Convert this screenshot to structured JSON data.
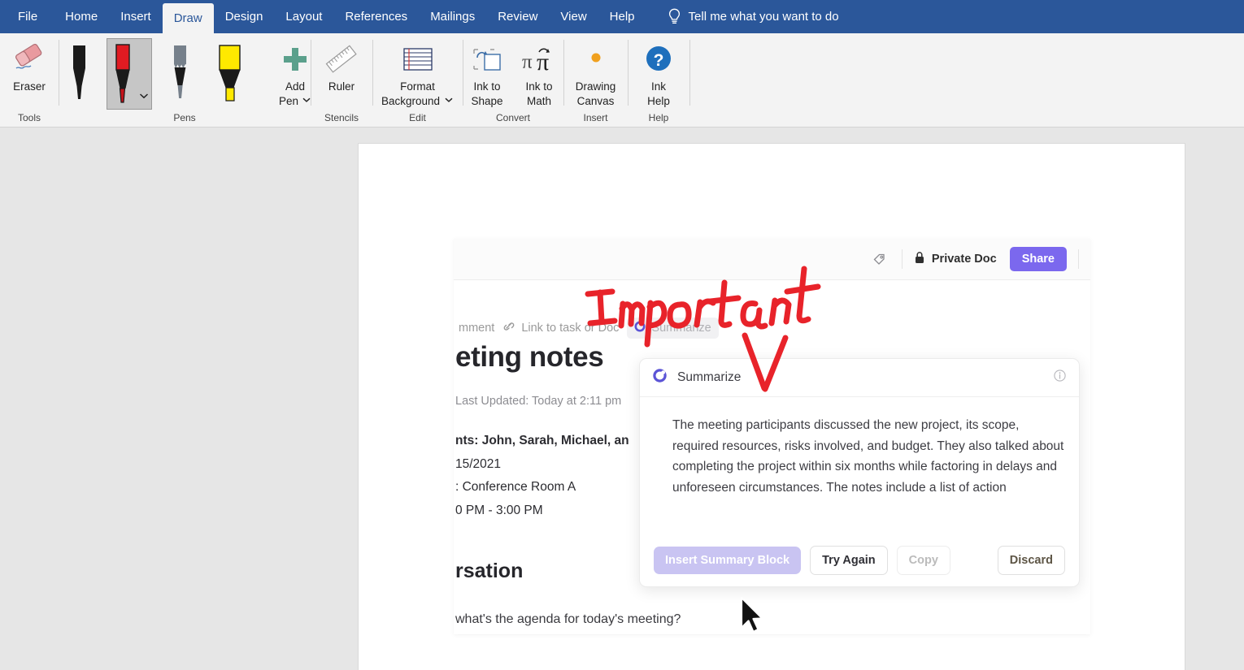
{
  "app": {
    "tabs": [
      {
        "label": "File",
        "active": false
      },
      {
        "label": "Home",
        "active": false
      },
      {
        "label": "Insert",
        "active": false
      },
      {
        "label": "Draw",
        "active": true
      },
      {
        "label": "Design",
        "active": false
      },
      {
        "label": "Layout",
        "active": false
      },
      {
        "label": "References",
        "active": false
      },
      {
        "label": "Mailings",
        "active": false
      },
      {
        "label": "Review",
        "active": false
      },
      {
        "label": "View",
        "active": false
      },
      {
        "label": "Help",
        "active": false
      }
    ],
    "tell_me": "Tell me what you want to do",
    "tell_me_icon": "lightbulb-icon"
  },
  "ribbon": {
    "groups": [
      {
        "name": "Tools",
        "label": "Tools",
        "items": [
          {
            "label": "Eraser",
            "icon": "eraser-icon"
          }
        ]
      },
      {
        "name": "Pens",
        "label": "Pens",
        "items": [
          {
            "label": "",
            "icon": "pen-black-icon",
            "selected": false
          },
          {
            "label": "",
            "icon": "pen-red-icon",
            "selected": true
          },
          {
            "label": "",
            "icon": "pencil-grey-icon",
            "selected": false
          },
          {
            "label": "",
            "icon": "highlighter-yellow-icon",
            "selected": false
          },
          {
            "label": "Add Pen",
            "icon": "plus-icon",
            "selected": false
          }
        ]
      },
      {
        "name": "Stencils",
        "label": "Stencils",
        "items": [
          {
            "label": "Ruler",
            "icon": "ruler-icon"
          }
        ]
      },
      {
        "name": "Edit",
        "label": "Edit",
        "items": [
          {
            "label": "Format Background",
            "icon": "format-background-icon"
          }
        ]
      },
      {
        "name": "Convert",
        "label": "Convert",
        "items": [
          {
            "label": "Ink to Shape",
            "icon": "ink-to-shape-icon"
          },
          {
            "label": "Ink to Math",
            "icon": "ink-to-math-icon"
          }
        ]
      },
      {
        "name": "Insert",
        "label": "Insert",
        "items": [
          {
            "label": "Drawing Canvas",
            "icon": "drawing-canvas-icon"
          }
        ]
      },
      {
        "name": "Help",
        "label": "Help",
        "items": [
          {
            "label": "Ink Help",
            "icon": "question-mark-icon"
          }
        ]
      }
    ],
    "labels": {
      "eraser": "Eraser",
      "add_pen_line1": "Add",
      "add_pen_line2": "Pen",
      "ruler": "Ruler",
      "format_bg_line1": "Format",
      "format_bg_line2": "Background",
      "ink_shape_line1": "Ink to",
      "ink_shape_line2": "Shape",
      "ink_math_line1": "Ink to",
      "ink_math_line2": "Math",
      "canvas_line1": "Drawing",
      "canvas_line2": "Canvas",
      "ink_help_line1": "Ink",
      "ink_help_line2": "Help",
      "group_tools": "Tools",
      "group_pens": "Pens",
      "group_stencils": "Stencils",
      "group_edit": "Edit",
      "group_convert": "Convert",
      "group_insert": "Insert",
      "group_help": "Help"
    }
  },
  "embedded_screenshot": {
    "header": {
      "tag_icon": "tag-icon",
      "lock_icon": "lock-icon",
      "privacy_label": "Private Doc",
      "share_label": "Share"
    },
    "toolbar": {
      "comment_label": "mment",
      "link_icon": "link-icon",
      "link_label": "Link to task or Doc",
      "summarize_icon": "ai-sparkle-icon",
      "summarize_label": "Summarize"
    },
    "document": {
      "title": "eting notes",
      "last_updated": "Last Updated: Today at 2:11 pm",
      "meta_lines": [
        "nts: John, Sarah, Michael, an",
        "15/2021",
        ": Conference Room A",
        "0 PM - 3:00 PM"
      ],
      "section_heading": "rsation",
      "first_message": "what's the agenda for today's meeting?"
    },
    "summarize_popover": {
      "icon": "ai-sparkle-icon",
      "title": "Summarize",
      "info_icon": "info-icon",
      "body": "The meeting participants discussed the new project, its scope, required resources, risks involved, and budget. They also talked about completing the project within six months while factoring in delays and unforeseen circumstances. The notes include a list of action",
      "actions": [
        {
          "label": "Insert Summary Block",
          "style": "primary"
        },
        {
          "label": "Try Again",
          "style": "ghost"
        },
        {
          "label": "Copy",
          "style": "muted"
        },
        {
          "label": "Discard",
          "style": "discard"
        }
      ]
    }
  },
  "ink_annotation": {
    "text": "Important",
    "shape": "down-arrow",
    "color": "#e8232a"
  },
  "colors": {
    "ribbon_blue": "#2b579a",
    "ribbon_bg": "#f3f3f3",
    "canvas_grey": "#e6e6e6",
    "accent_purple": "#7b68ee",
    "ink_red": "#e8232a"
  },
  "cursor": {
    "icon": "mouse-pointer-icon"
  }
}
